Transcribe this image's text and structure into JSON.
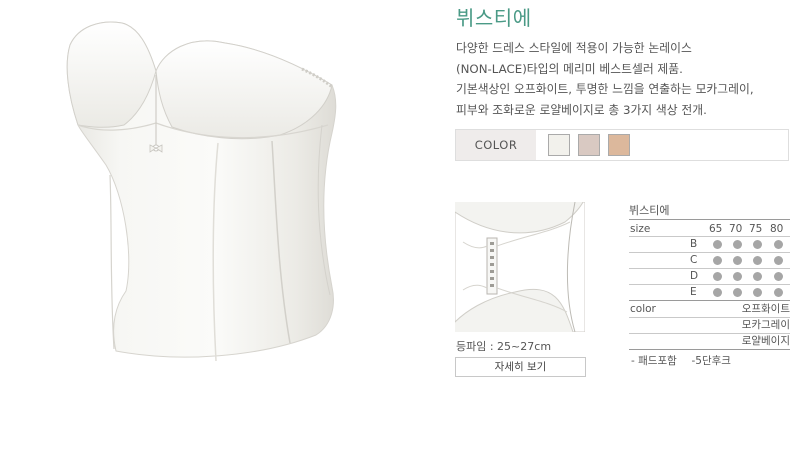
{
  "product": {
    "title": "뷔스티에",
    "description": [
      "다양한 드레스 스타일에 적용이 가능한 논레이스",
      "(NON-LACE)타입의 메리미 베스트셀러 제품.",
      "기본색상인 오프화이트, 투명한 느낌을 연출하는 모카그레이,",
      "피부와 조화로운 로얄베이지로 총 3가지 색상 전개."
    ]
  },
  "color_bar": {
    "label": "COLOR",
    "swatches": [
      {
        "name": "오프화이트",
        "hex": "#f2f1ec"
      },
      {
        "name": "모카그레이",
        "hex": "#d9c9c2"
      },
      {
        "name": "로얄베이지",
        "hex": "#dcb89c"
      }
    ]
  },
  "detail": {
    "back_text": "등파임 : 25~27cm",
    "button_label": "자세히 보기"
  },
  "size_table": {
    "title": "뷔스티에",
    "size_label": "size",
    "bands": [
      "65",
      "70",
      "75",
      "80"
    ],
    "cups": [
      {
        "cup": "B",
        "available": [
          true,
          true,
          true,
          true
        ]
      },
      {
        "cup": "C",
        "available": [
          true,
          true,
          true,
          true
        ]
      },
      {
        "cup": "D",
        "available": [
          true,
          true,
          true,
          true
        ]
      },
      {
        "cup": "E",
        "available": [
          true,
          true,
          true,
          true
        ]
      }
    ],
    "color_label": "color",
    "colors": [
      "오프화이트",
      "모카그레이",
      "로얄베이지"
    ]
  },
  "notes": {
    "pad": "- 패드포함",
    "hook": "-5단후크"
  },
  "icons": {
    "size_dot": "filled-circle"
  },
  "palette": {
    "accent": "#4a9a86",
    "dot": "#a6a6a6"
  }
}
